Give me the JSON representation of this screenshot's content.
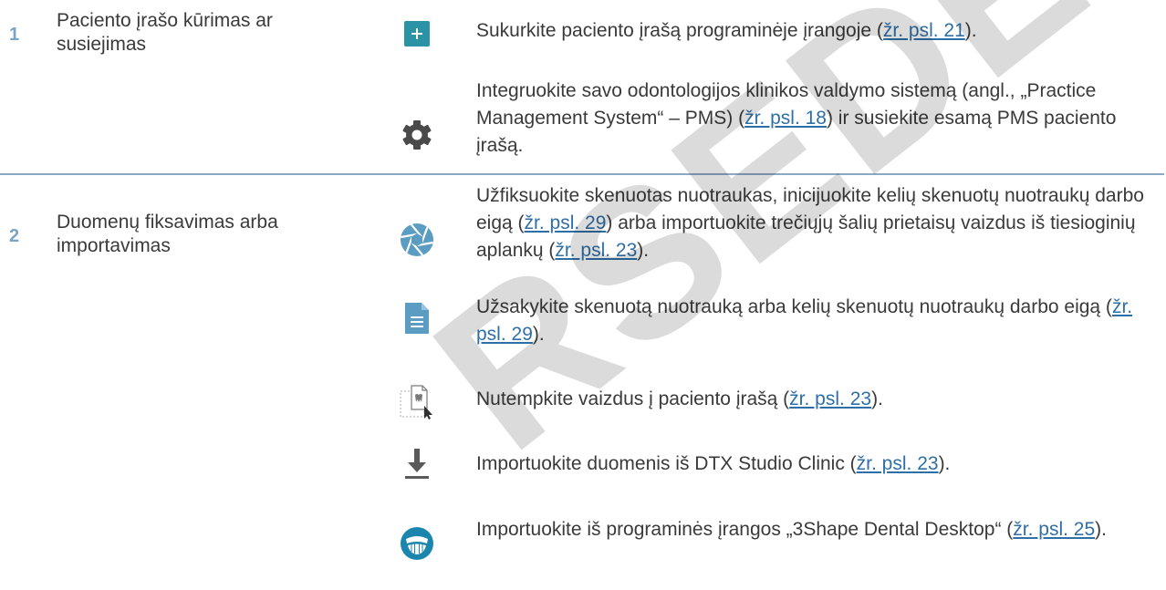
{
  "sections": [
    {
      "number": "1",
      "title": "Paciento įrašo kūrimas ar susiejimas",
      "items": [
        {
          "icon": "plus-icon",
          "parts": [
            {
              "t": "Sukurkite paciento įrašą programinėje įrangoje ("
            },
            {
              "t": "žr. psl. 21",
              "link": true
            },
            {
              "t": ")."
            }
          ]
        },
        {
          "icon": "gear-icon",
          "parts": [
            {
              "t": "Integruokite savo odontologijos klinikos valdymo sistemą (angl., „Practice Management System“ – PMS) ("
            },
            {
              "t": "žr. psl. 18",
              "link": true
            },
            {
              "t": ") ir susiekite esamą PMS paciento įrašą."
            }
          ]
        }
      ]
    },
    {
      "number": "2",
      "title": "Duomenų fiksavimas arba importavimas",
      "items": [
        {
          "icon": "aperture-icon",
          "parts": [
            {
              "t": "Užfiksuokite skenuotas nuotraukas, inicijuokite kelių skenuotų nuotraukų darbo eigą ("
            },
            {
              "t": "žr. psl. 29",
              "link": true
            },
            {
              "t": ") arba importuokite trečiųjų šalių prietaisų vaizdus iš tiesioginių aplankų ("
            },
            {
              "t": "žr. psl. 23",
              "link": true
            },
            {
              "t": ")."
            }
          ]
        },
        {
          "icon": "document-icon",
          "parts": [
            {
              "t": "Užsakykite skenuotą nuotrauką arba kelių skenuotų nuotraukų darbo eigą ("
            },
            {
              "t": "žr. psl. 29",
              "link": true
            },
            {
              "t": ")."
            }
          ]
        },
        {
          "icon": "drag-drop-image-icon",
          "parts": [
            {
              "t": "Nutempkite vaizdus į paciento įrašą ("
            },
            {
              "t": "žr. psl. 23",
              "link": true
            },
            {
              "t": ")."
            }
          ]
        },
        {
          "icon": "download-icon",
          "parts": [
            {
              "t": "Importuokite duomenis iš DTX Studio Clinic ("
            },
            {
              "t": "žr. psl. 23",
              "link": true
            },
            {
              "t": ")."
            }
          ]
        },
        {
          "icon": "dental-arch-icon",
          "parts": [
            {
              "t": "Importuokite iš programinės įrangos „3Shape Dental Desktop“ ("
            },
            {
              "t": "žr. psl. 25",
              "link": true
            },
            {
              "t": ")."
            }
          ]
        }
      ]
    }
  ],
  "watermark": "RSEDED",
  "colors": {
    "accent_teal": "#2b93a6",
    "icon_gray": "#4a4a4a",
    "icon_blue": "#5b9dc2",
    "link": "#2f6fa7",
    "divider": "#8aa9c5"
  }
}
